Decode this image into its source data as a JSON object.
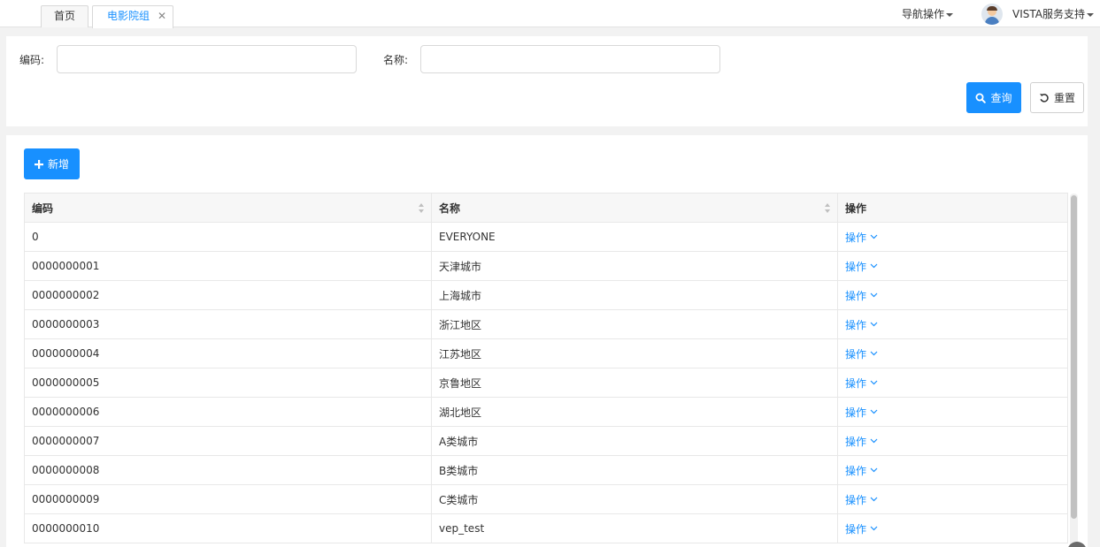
{
  "tabs": [
    {
      "label": "首页",
      "active": false
    },
    {
      "label": "电影院组",
      "active": true
    }
  ],
  "tab_close": "✕",
  "header": {
    "nav_ops_label": "导航操作",
    "user_label": "VISTA服务支持"
  },
  "search": {
    "code_label": "编码:",
    "code_value": "",
    "name_label": "名称:",
    "name_value": "",
    "query_label": "查询",
    "reset_label": "重置"
  },
  "toolbar": {
    "add_label": "新增"
  },
  "table": {
    "columns": [
      "编码",
      "名称",
      "操作"
    ],
    "action_label": "操作",
    "rows": [
      {
        "code": "0",
        "name": "EVERYONE"
      },
      {
        "code": "0000000001",
        "name": "天津城市"
      },
      {
        "code": "0000000002",
        "name": "上海城市"
      },
      {
        "code": "0000000003",
        "name": "浙江地区"
      },
      {
        "code": "0000000004",
        "name": "江苏地区"
      },
      {
        "code": "0000000005",
        "name": "京鲁地区"
      },
      {
        "code": "0000000006",
        "name": "湖北地区"
      },
      {
        "code": "0000000007",
        "name": "A类城市"
      },
      {
        "code": "0000000008",
        "name": "B类城市"
      },
      {
        "code": "0000000009",
        "name": "C类城市"
      },
      {
        "code": "0000000010",
        "name": "vep_test"
      }
    ]
  },
  "colors": {
    "primary": "#1890ff",
    "header_bg": "#f7f7f7",
    "page_bg": "#f2f2f2"
  },
  "icons": {
    "query": "search-icon",
    "reset": "reset-icon",
    "add": "plus-icon",
    "action_dropdown": "chevron-down-icon",
    "sort": "sort-icon"
  }
}
